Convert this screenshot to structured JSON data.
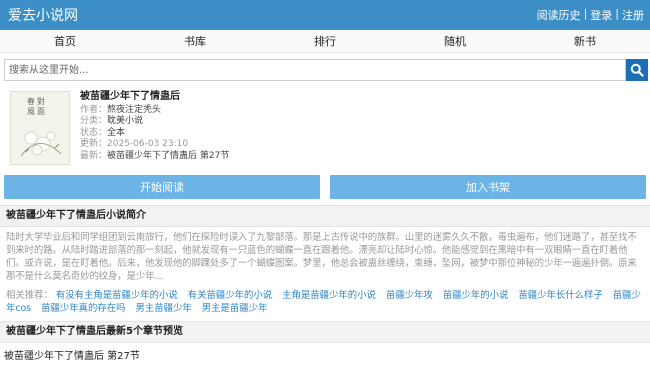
{
  "site": {
    "title": "爱去小说网",
    "links": [
      "阅读历史",
      "登录",
      "注册"
    ]
  },
  "nav": [
    "首页",
    "书库",
    "排行",
    "随机",
    "新书"
  ],
  "search": {
    "placeholder": "搜索从这里开始..."
  },
  "book": {
    "title": "被苗疆少年下了情蛊后",
    "cover_text": "春風對面",
    "author_label": "作者：",
    "author": "熬夜注定秃头",
    "category_label": "分类：",
    "category": "耽美小说",
    "status_label": "状态：",
    "status": "全本",
    "updated_label": "更新：",
    "updated": "2025-06-03 23:10",
    "latest_label": "最新：",
    "latest": "被苗疆少年下了情蛊后 第27节"
  },
  "buttons": {
    "read": "开始阅读",
    "shelf": "加入书架"
  },
  "intro": {
    "heading": "被苗疆少年下了情蛊后小说简介",
    "text": "陆时大学毕业后和同学组团到云南旅行，他们在探险时误入了九黎部落。那是上古传说中的族群。山里的迷雾久久不散，毒虫遍布，他们迷路了，甚至找不到来时的路。从陆时踏进部落的那一刻起，他就发现有一只蓝色的蝴蝶一直在跟着他。漂亮却让陆时心惊。他能感觉到在黑暗中有一双眼睛一直在盯着他们。或许说，是在盯着他。后来，他发现他的脚踝处多了一个蝴蝶图案。梦里，他总会被蛊丝缠绕，束缚，坠网，被梦中那位神秘的少年一遍遍扑倒。原来那不是什么莫名奇妙的纹身，是少年..."
  },
  "related": {
    "label": "相关推荐：",
    "items": [
      "有没有主角是苗疆少年的小说",
      "有关苗疆少年的小说",
      "主角是苗疆少年的小说",
      "苗疆少年攻",
      "苗疆少年的小说",
      "苗疆少年长什么样子",
      "苗疆少年cos",
      "苗疆少年真的存在吗",
      "男主苗疆少年",
      "男主是苗疆少年"
    ]
  },
  "chapters": {
    "heading": "被苗疆少年下了情蛊后最新5个章节预览",
    "items": [
      "被苗疆少年下了情蛊后 第27节"
    ]
  }
}
